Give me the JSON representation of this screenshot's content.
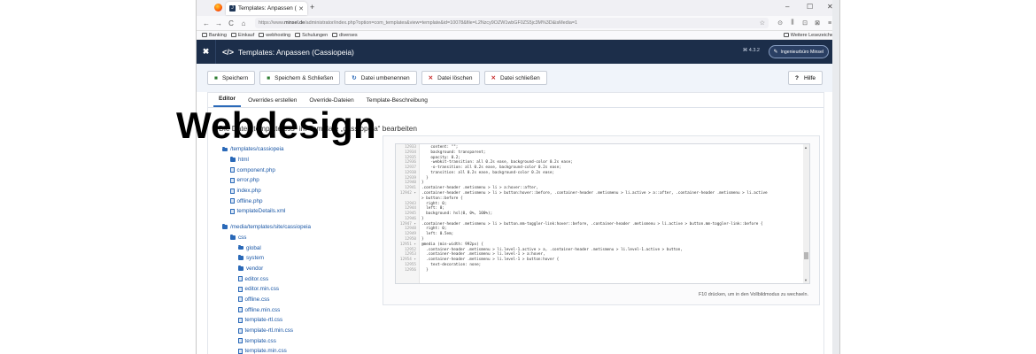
{
  "browser": {
    "tab_title": "Templates: Anpassen (Cassiopeia)",
    "tab_close": "✕",
    "new_tab": "+",
    "window_controls": [
      "–",
      "☐",
      "✕"
    ],
    "nav": [
      "←",
      "→",
      "C",
      "⌂"
    ],
    "url_prefix": "https://www.",
    "url_domain": "minsel.de",
    "url_rest": "/administrator/index.php?option=com_templates&view=template&id=10078&file=L2Nzcy9OZW1wbGF0ZS5jc3M%3D&isMedia=1",
    "url_star": "☆",
    "right_icons": [
      "⊙",
      "⫼",
      "⊡",
      "⊠",
      "≡"
    ],
    "bookmarks": [
      "Banking",
      "Einkauf",
      "webhosting",
      "Schulungen",
      "diverses"
    ],
    "bookmarks_right": "Weitere Lesezeichen"
  },
  "header": {
    "logo": "✖",
    "title_icon": "</>",
    "title": "Templates: Anpassen (Cassiopeia)",
    "version": "⌘ 4.3.2",
    "user_icon": "✎",
    "user": "Ingenieurbüro Minsel"
  },
  "toolbar": {
    "buttons": [
      {
        "icon": "💾",
        "label": "Speichern"
      },
      {
        "icon": "💾",
        "label": "Speichern & Schließen"
      },
      {
        "icon": "↻",
        "label": "Datei umbenennen"
      },
      {
        "icon": "✕",
        "label": "Datei löschen"
      },
      {
        "icon": "✕",
        "label": "Datei schließen"
      }
    ],
    "help_icon": "?",
    "help": "Hilfe"
  },
  "tabs": [
    "Editor",
    "Overrides erstellen",
    "Override-Dateien",
    "Template-Beschreibung"
  ],
  "edit_heading": "Die Datei „template.css“ im Template „cassiopeia“ bearbeiten",
  "tree": {
    "root1": "/templates/cassiopeia",
    "root1_items": [
      {
        "type": "folder",
        "name": "html"
      },
      {
        "type": "file",
        "name": "component.php"
      },
      {
        "type": "file",
        "name": "error.php"
      },
      {
        "type": "file",
        "name": "index.php"
      },
      {
        "type": "file",
        "name": "offline.php"
      },
      {
        "type": "file",
        "name": "templateDetails.xml"
      }
    ],
    "root2": "/media/templates/site/cassiopeia",
    "css_folder": "css",
    "css_items": [
      {
        "type": "folder",
        "name": "global"
      },
      {
        "type": "folder",
        "name": "system"
      },
      {
        "type": "folder",
        "name": "vendor"
      },
      {
        "type": "file",
        "name": "editor.css"
      },
      {
        "type": "file",
        "name": "editor.min.css"
      },
      {
        "type": "file",
        "name": "offline.css"
      },
      {
        "type": "file",
        "name": "offline.min.css"
      },
      {
        "type": "file",
        "name": "template-rtl.css"
      },
      {
        "type": "file",
        "name": "template-rtl.min.css"
      },
      {
        "type": "file",
        "name": "template.css"
      },
      {
        "type": "file",
        "name": "template.min.css"
      }
    ]
  },
  "code": [
    {
      "n": "12933",
      "t": "    content: \"\";"
    },
    {
      "n": "12934",
      "t": "    background: transparent;"
    },
    {
      "n": "12935",
      "t": "    opacity: 0.2;"
    },
    {
      "n": "12936",
      "t": "    -webkit-transition: all 0.2s ease, background-color 0.2s ease;"
    },
    {
      "n": "12937",
      "t": "    -o-transition: all 0.2s ease, background-color 0.2s ease;"
    },
    {
      "n": "12938",
      "t": "    transition: all 0.2s ease, background-color 0.2s ease;"
    },
    {
      "n": "12939",
      "t": "  }"
    },
    {
      "n": "12940",
      "t": "}"
    },
    {
      "n": "12941",
      "t": ".container-header .metismenu > li > a:hover::after,"
    },
    {
      "n": "12942 ▾",
      "t": ".container-header .metismenu > li > button:hover::before, .container-header .metismenu > li.active > a::after, .container-header .metismenu > li.active"
    },
    {
      "n": "",
      "t": "> button::before {"
    },
    {
      "n": "12943",
      "t": "  right: 0;"
    },
    {
      "n": "12944",
      "t": "  left: 0;"
    },
    {
      "n": "12945",
      "t": "  background: hsl(0, 0%, 100%);"
    },
    {
      "n": "12946",
      "t": "}"
    },
    {
      "n": "12947 ▾",
      "t": ".container-header .metismenu > li > button.mm-toggler-link:hover::before, .container-header .metismenu > li.active > button.mm-toggler-link::before {"
    },
    {
      "n": "12948",
      "t": "  right: 0;"
    },
    {
      "n": "12949",
      "t": "  left: 0.5em;"
    },
    {
      "n": "12950",
      "t": "}"
    },
    {
      "n": "12951 ▾",
      "t": "@media (min-width: 992px) {"
    },
    {
      "n": "12952",
      "t": "  .container-header .metismenu > li.level-1.active > a, .container-header .metismenu > li.level-1.active > button,"
    },
    {
      "n": "12953",
      "t": "  .container-header .metismenu > li.level-1 > a:hover,"
    },
    {
      "n": "12954 ▾",
      "t": "  .container-header .metismenu > li.level-1 > button:hover {"
    },
    {
      "n": "12955",
      "t": "    text-decoration: none;"
    },
    {
      "n": "12956",
      "t": "  }"
    }
  ],
  "f10_note": "F10 drücken, um in den Vollbildmodus zu wechseln.",
  "watermark": "Webdesign",
  "colors": {
    "header_bg": "#1c2e4a",
    "accent": "#2a69b8",
    "toolbar_bg": "#f0f4fa"
  }
}
